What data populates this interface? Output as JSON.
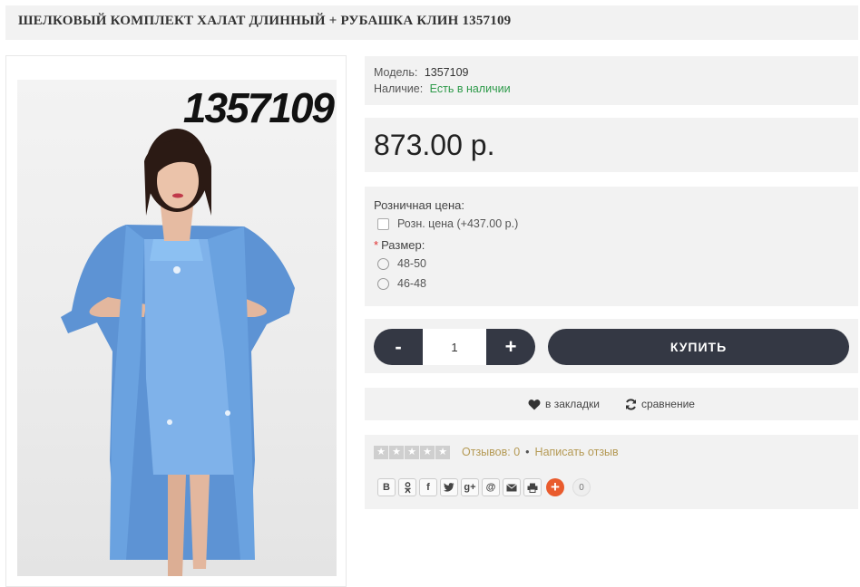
{
  "product": {
    "title": "ШЕЛКОВЫЙ КОМПЛЕКТ ХАЛАТ ДЛИННЫЙ + РУБАШКА КЛИН 1357109",
    "image_code": "1357109"
  },
  "info": {
    "model_label": "Модель:",
    "model_value": "1357109",
    "stock_label": "Наличие:",
    "stock_value": "Есть в наличии"
  },
  "price": "873.00 р.",
  "options": {
    "retail_heading": "Розничная цена:",
    "retail_checkbox_label": "Розн. цена (+437.00 р.)",
    "size_required_mark": "*",
    "size_heading": "Размер:",
    "sizes": [
      "48-50",
      "46-48"
    ]
  },
  "purchase": {
    "minus_label": "-",
    "quantity": "1",
    "plus_label": "+",
    "buy_label": "КУПИТЬ"
  },
  "actions": {
    "wishlist_label": "в закладки",
    "compare_label": "сравнение"
  },
  "reviews": {
    "reviews_link": "Отзывов: 0",
    "separator": "•",
    "write_review_link": "Написать отзыв"
  },
  "share": {
    "buttons": [
      "В",
      "ок",
      "f",
      "twitter",
      "g+",
      "@",
      "mail",
      "print"
    ],
    "count": "0"
  },
  "colors": {
    "panel_bg": "#f2f2f2",
    "dark_button": "#343844",
    "stock_green": "#2e9a4a",
    "link_gold": "#b59a55",
    "share_orange": "#e95b2d"
  }
}
